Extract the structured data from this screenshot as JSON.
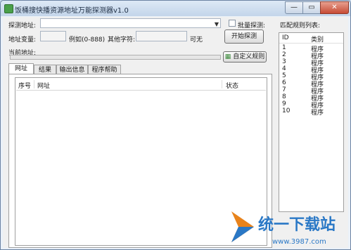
{
  "window": {
    "title": "饭桶搜快播资源地址万能探测器v1.0",
    "controls": [
      "—",
      "▭",
      "✕"
    ]
  },
  "form": {
    "probe_url_label": "探测地址:",
    "probe_url_value": "",
    "batch_probe_label": "批量探测:",
    "batch_probe_checked": false,
    "addr_var_label": "地址变量:",
    "addr_var_value": "",
    "example_text": "例如(0-888)",
    "other_char_label": "其他字符:",
    "other_char_value": "",
    "optional_text": "可无",
    "current_addr_label": "当前地址:",
    "start_button": "开始探测",
    "custom_rule_button": "自定义规则",
    "progress": 0.0
  },
  "tabs": [
    "网址",
    "结果",
    "输出信息",
    "程序帮助"
  ],
  "active_tab": 0,
  "grid": {
    "columns": [
      "序号",
      "网址",
      "状态"
    ],
    "rows": []
  },
  "rules": {
    "title": "匹配规则列表:",
    "columns": [
      "ID",
      "类别"
    ],
    "rows": [
      {
        "id": "1",
        "type": "程序"
      },
      {
        "id": "2",
        "type": "程序"
      },
      {
        "id": "3",
        "type": "程序"
      },
      {
        "id": "4",
        "type": "程序"
      },
      {
        "id": "5",
        "type": "程序"
      },
      {
        "id": "6",
        "type": "程序"
      },
      {
        "id": "7",
        "type": "程序"
      },
      {
        "id": "8",
        "type": "程序"
      },
      {
        "id": "9",
        "type": "程序"
      },
      {
        "id": "10",
        "type": "程序"
      }
    ]
  },
  "watermark": {
    "brand": "统一下载站",
    "url": "www.3987.com"
  },
  "colors": {
    "progress": "#4cc44c",
    "titlebar": "#c3d5ea",
    "brand_orange": "#e8831c",
    "brand_blue": "#2a78c6"
  }
}
